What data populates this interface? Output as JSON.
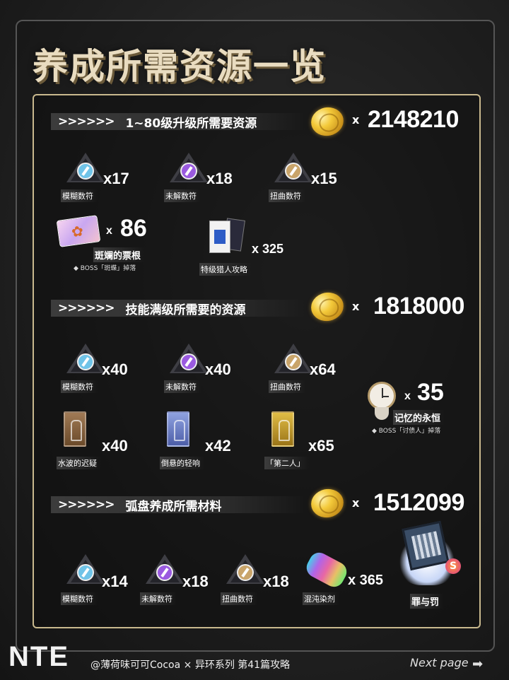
{
  "title": "养成所需资源一览",
  "sections": [
    {
      "header_arrows": ">>>>>>",
      "header": "1~80级升级所需要资源",
      "coin_x": "x",
      "coin_value": "2148210",
      "items": [
        {
          "name": "模糊数符",
          "qty": "x17"
        },
        {
          "name": "未解数符",
          "qty": "x18"
        },
        {
          "name": "扭曲数符",
          "qty": "x15"
        },
        {
          "name": "斑斓的票根",
          "qty_x": "x",
          "qty": "86",
          "note": "◆ BOSS「斑蝶」掉落"
        },
        {
          "name": "特级猎人攻略",
          "qty": "x 325"
        }
      ]
    },
    {
      "header_arrows": ">>>>>>",
      "header": "技能满级所需要的资源",
      "coin_x": "x",
      "coin_value": "1818000",
      "items": [
        {
          "name": "模糊数符",
          "qty": "x40"
        },
        {
          "name": "未解数符",
          "qty": "x40"
        },
        {
          "name": "扭曲数符",
          "qty": "x64"
        },
        {
          "name": "水波的迟疑",
          "qty": "x40"
        },
        {
          "name": "倒悬的轻响",
          "qty": "x42"
        },
        {
          "name": "「第二人」",
          "qty": "x65"
        },
        {
          "name": "记忆的永恒",
          "qty_x": "x",
          "qty": "35",
          "note": "◆ BOSS「讨债人」掉落"
        }
      ]
    },
    {
      "header_arrows": ">>>>>>",
      "header": "弧盘养成所需材料",
      "coin_x": "x",
      "coin_value": "1512099",
      "items": [
        {
          "name": "模糊数符",
          "qty": "x14"
        },
        {
          "name": "未解数符",
          "qty": "x18"
        },
        {
          "name": "扭曲数符",
          "qty": "x18"
        },
        {
          "name": "混沌染剂",
          "qty": "x 365"
        },
        {
          "name": "罪与罚",
          "badge": "S"
        }
      ]
    }
  ],
  "footer": {
    "logo": "NTE",
    "credit": "@薄荷味可可Cocoa × 异环系列 第41篇攻略",
    "next": "Next page",
    "arrow": "➡"
  },
  "colors": {
    "coin": "#f3c93a",
    "panel_border": "#c9b98e",
    "blurry_gem": "#6fc3e8",
    "unsolved_gem": "#9a5ae0",
    "twisted_gem": "#c9a46a",
    "water_card": "#8a6a48",
    "hanging_card": "#6b7fc9",
    "second_card": "#c9a236"
  },
  "icons": [
    "coin-icon",
    "blurry-rune-icon",
    "unsolved-rune-icon",
    "twisted-rune-icon",
    "ticket-stub-icon",
    "hunter-guide-icon",
    "water-hesitation-icon",
    "hanging-echo-icon",
    "second-person-icon",
    "eternal-memory-clock-icon",
    "chaos-dye-icon",
    "crime-punishment-book-icon"
  ]
}
